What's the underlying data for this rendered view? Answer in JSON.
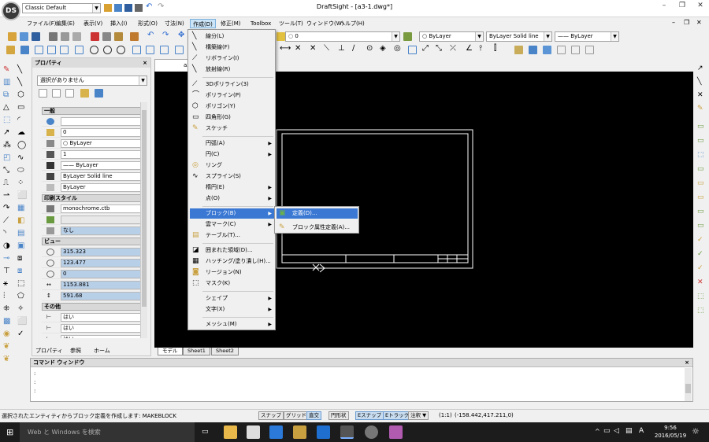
{
  "window": {
    "title": "DraftSight - [a3-1.dwg*]",
    "workspace": "Classic Default",
    "logo_text": "DS",
    "min": "–",
    "restore": "❐",
    "close": "✕",
    "inner_min": "–",
    "inner_restore": "❐",
    "inner_close": "✕"
  },
  "menubar": [
    "ファイル(F)",
    "編集(E)",
    "表示(V)",
    "挿入(I)",
    "形式(O)",
    "寸法(N)",
    "作成(D)",
    "修正(M)",
    "Toolbox",
    "ツール(T)",
    "ウィンドウ(W)",
    "ヘルプ(H)"
  ],
  "layer_toolbar": {
    "layer": "0",
    "color": "ByLayer",
    "linetype": "ByLayer    Solid line",
    "lineweight": "—— ByLayer"
  },
  "properties": {
    "title": "プロパティ",
    "close": "×",
    "selection": "選択がありません",
    "sections": {
      "general": "一般",
      "print_style": "印刷スタイル",
      "view": "ビュー",
      "other": "その他"
    },
    "general_rows": [
      "",
      "0",
      "○ ByLayer",
      "1",
      "—— ByLayer",
      "ByLayer    Solid line",
      "ByLayer"
    ],
    "print_rows": [
      "monochrome.ctb",
      "",
      "なし"
    ],
    "view_rows": [
      "315.323",
      "123.477",
      "0",
      "1153.881",
      "591.68"
    ],
    "other_rows": [
      "はい",
      "はい",
      "はい"
    ],
    "bottom_tabs": [
      "プロパティ",
      "参照",
      "ホーム"
    ]
  },
  "drawing": {
    "tabs": [
      "モデル",
      "Sheet1",
      "Sheet2"
    ],
    "doc_tab": "a3-"
  },
  "create_menu": [
    {
      "label": "線分(L)",
      "icon": "line-icon"
    },
    {
      "label": "構築線(F)",
      "icon": "construction-line-icon"
    },
    {
      "label": "リボライン(I)",
      "icon": "polyline-icon"
    },
    {
      "label": "放射線(R)",
      "icon": "ray-icon"
    },
    {
      "label": "3Dポリライン(3)",
      "icon": "3d-polyline-icon"
    },
    {
      "label": "ポリライン(P)",
      "icon": "polyline-icon"
    },
    {
      "label": "ポリゴン(Y)",
      "icon": "polygon-icon"
    },
    {
      "label": "四角形(G)",
      "icon": "rectangle-icon"
    },
    {
      "label": "スケッチ",
      "icon": "sketch-icon"
    },
    {
      "label": "円弧(A)",
      "submenu": true
    },
    {
      "label": "円(C)",
      "submenu": true
    },
    {
      "label": "リング",
      "icon": "ring-icon"
    },
    {
      "label": "スプライン(S)",
      "icon": "spline-icon"
    },
    {
      "label": "楕円(E)",
      "submenu": true
    },
    {
      "label": "点(O)",
      "submenu": true
    },
    {
      "label": "ブロック(B)",
      "submenu": true
    },
    {
      "label": "雲マーク(C)",
      "submenu": true
    },
    {
      "label": "テーブル(T)...",
      "icon": "table-icon"
    },
    {
      "label": "囲まれた領域(D)...",
      "icon": "region-icon"
    },
    {
      "label": "ハッチング/塗り潰し(H)...",
      "icon": "hatch-icon"
    },
    {
      "label": "リージョン(N)",
      "icon": "region-icon"
    },
    {
      "label": "マスク(K)",
      "icon": "mask-icon"
    },
    {
      "label": "シェイプ",
      "submenu": true
    },
    {
      "label": "文字(X)",
      "submenu": true
    },
    {
      "label": "メッシュ(M)",
      "submenu": true
    }
  ],
  "block_submenu": [
    {
      "label": "定義(D)...",
      "icon": "block-define-icon"
    },
    {
      "label": "ブロック属性定義(A)...",
      "icon": "attribute-icon"
    }
  ],
  "command_window": {
    "title": "コマンド ウィンドウ",
    "close": "×",
    "lines": [
      ":",
      ":",
      ":"
    ]
  },
  "status": {
    "message": "選択されたエンティティからブロック定義を作成します: MAKEBLOCK",
    "buttons": [
      "スナップ",
      "グリッド",
      "直交",
      "円形状",
      "Eスナップ",
      "Eトラック"
    ],
    "annotation": "注釈",
    "scale": "(1:1)",
    "coords": "(-158.442,417.211,0)"
  },
  "taskbar": {
    "search_placeholder": "Web と Windows を検索",
    "time": "9:56",
    "date": "2016/05/19",
    "ime": "A"
  }
}
